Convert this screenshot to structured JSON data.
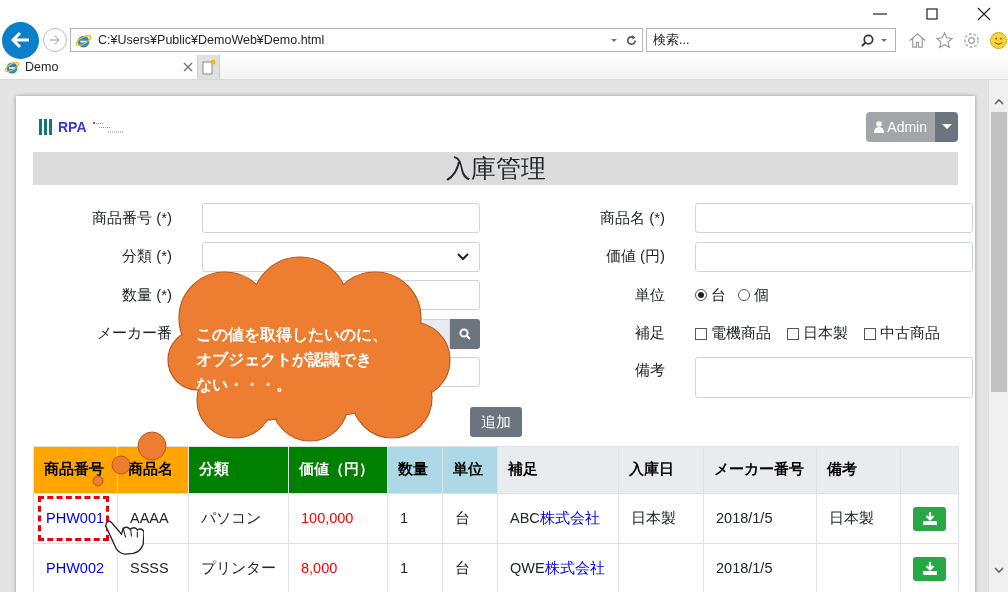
{
  "browser": {
    "address": "C:¥Users¥Public¥DemoWeb¥Demo.html",
    "search": {
      "placeholder": "検索..."
    },
    "tabs": [
      {
        "label": "Demo",
        "selected": true
      }
    ]
  },
  "header": {
    "logo": "RPA",
    "user_button": "Admin"
  },
  "page_title": "入庫管理",
  "form": {
    "left": [
      {
        "label": "商品番号 (*)",
        "kind": "text"
      },
      {
        "label": "分類 (*)",
        "kind": "select"
      },
      {
        "label": "数量 (*)",
        "kind": "text"
      },
      {
        "label": "メーカー番",
        "kind": "search"
      },
      {
        "kind": "text"
      }
    ],
    "right": [
      {
        "label": "商品名 (*)",
        "kind": "text"
      },
      {
        "label": "価値 (円)",
        "kind": "text"
      },
      {
        "label": "単位",
        "kind": "radio",
        "options": [
          {
            "label": "台",
            "selected": true
          },
          {
            "label": "個",
            "selected": false
          }
        ]
      },
      {
        "label": "補足",
        "kind": "checkbox",
        "options": [
          {
            "label": "電機商品",
            "checked": false
          },
          {
            "label": "日本製",
            "checked": false
          },
          {
            "label": "中古商品",
            "checked": false
          }
        ]
      },
      {
        "label": "備考",
        "kind": "textarea"
      }
    ]
  },
  "add_button": "追加",
  "table": {
    "columns": [
      {
        "label": "商品番号",
        "color": "#ffa500",
        "kind": "link"
      },
      {
        "label": "商品名",
        "color": "#ffa500",
        "kind": "text"
      },
      {
        "label": "分類",
        "color": "#008000",
        "kind": "text"
      },
      {
        "label": "価値（円）",
        "color": "#008000",
        "kind": "price"
      },
      {
        "label": "数量",
        "color": "#add8e6",
        "kind": "text"
      },
      {
        "label": "単位",
        "color": "#add8e6",
        "kind": "text"
      },
      {
        "label": "補足",
        "color": "#e9ecef",
        "kind": "supplement"
      },
      {
        "label": "入庫日",
        "color": "#e9ecef",
        "kind": "text"
      },
      {
        "label": "メーカー番号",
        "color": "#e9ecef",
        "kind": "text"
      },
      {
        "label": "備考",
        "color": "#e9ecef",
        "kind": "text"
      },
      {
        "color": "#e9ecef",
        "kind": "action"
      }
    ],
    "rows": [
      {
        "marked": true,
        "cells": [
          "PHW001",
          "AAAA",
          "パソコン",
          "100,000",
          "1",
          "台",
          {
            "text": "ABC",
            "link": "株式会社"
          },
          "日本製",
          "2018/1/5",
          "日本製",
          null
        ]
      },
      {
        "marked": false,
        "cells": [
          "PHW002",
          "SSSS",
          "プリンター",
          "8,000",
          "1",
          "台",
          {
            "text": "QWE",
            "link": "株式会社"
          },
          null,
          "2018/1/5",
          null,
          null
        ]
      }
    ]
  },
  "callout": {
    "lines": [
      "この値を取得したいのに、",
      "オブジェクトが認識でき",
      "ない・・・。"
    ]
  }
}
